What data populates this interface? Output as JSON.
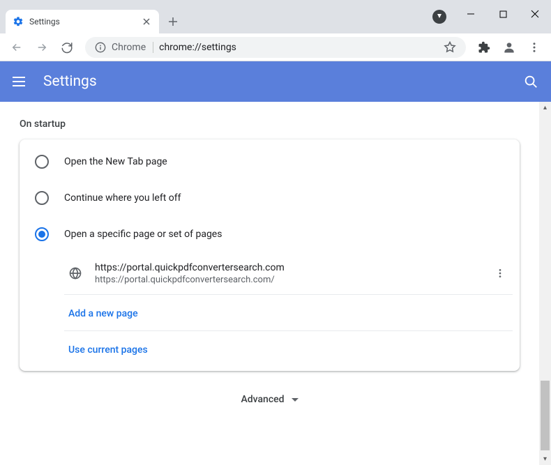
{
  "window": {
    "tab_title": "Settings",
    "omnibox_prefix": "Chrome",
    "omnibox_url": "chrome://settings"
  },
  "header": {
    "title": "Settings"
  },
  "section": {
    "title": "On startup",
    "options": [
      {
        "label": "Open the New Tab page",
        "selected": false
      },
      {
        "label": "Continue where you left off",
        "selected": false
      },
      {
        "label": "Open a specific page or set of pages",
        "selected": true
      }
    ],
    "pages": [
      {
        "title": "https://portal.quickpdfconvertersearch.com",
        "url": "https://portal.quickpdfconvertersearch.com/"
      }
    ],
    "add_page_label": "Add a new page",
    "use_current_label": "Use current pages"
  },
  "advanced_label": "Advanced"
}
